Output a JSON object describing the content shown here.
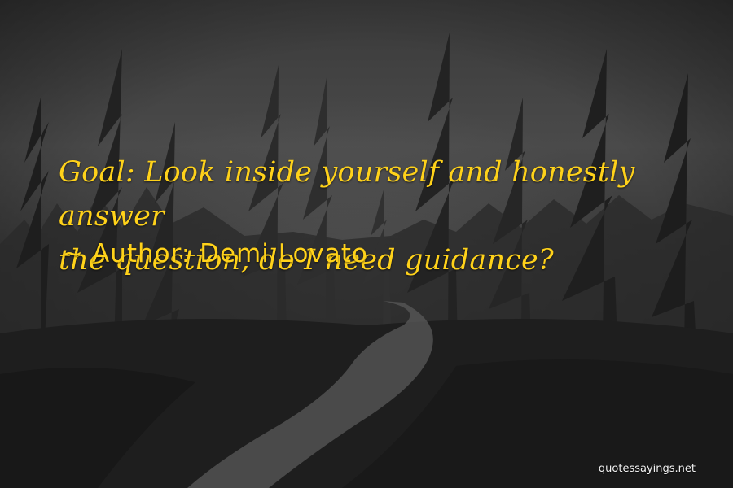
{
  "quote": {
    "line1": "Goal: Look inside yourself and honestly answer",
    "line2": "the question, do I need guidance?"
  },
  "author": {
    "prefix": "~",
    "label": "Author: Demi Lovato"
  },
  "watermark": "quotessayings.net",
  "colors": {
    "quote_text": "#ffd21a",
    "watermark_text": "#f2f2f2",
    "background": "#333333"
  }
}
